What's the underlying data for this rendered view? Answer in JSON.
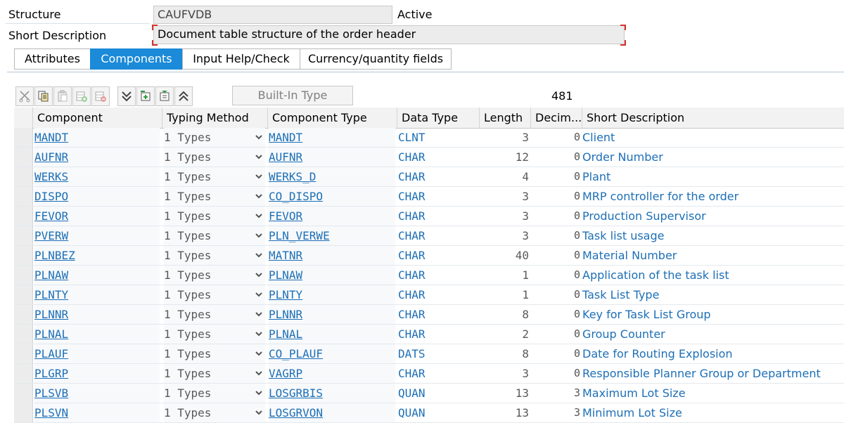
{
  "header": {
    "structure_label": "Structure",
    "structure_value": "CAUFVDB",
    "status": "Active",
    "short_desc_label": "Short Description",
    "short_desc_value": "Document table structure of the order header"
  },
  "tabs": [
    {
      "label": "Attributes",
      "active": false
    },
    {
      "label": "Components",
      "active": true
    },
    {
      "label": "Input Help/Check",
      "active": false
    },
    {
      "label": "Currency/quantity fields",
      "active": false
    }
  ],
  "toolbar": {
    "builtin_type_label": "Built-In Type",
    "count": "481",
    "icons": [
      "cut-icon",
      "copy-icon",
      "paste-icon",
      "insert-row-icon",
      "delete-row-icon",
      "collapse-icon",
      "new-field-icon",
      "new-include-icon",
      "expand-icon"
    ]
  },
  "columns": [
    "Component",
    "Typing Method",
    "Component Type",
    "Data Type",
    "Length",
    "Decim...",
    "Short Description"
  ],
  "rows": [
    {
      "component": "MANDT",
      "typing": "1 Types",
      "ctype": "MANDT",
      "dtype": "CLNT",
      "length": "3",
      "dec": "0",
      "desc": "Client"
    },
    {
      "component": "AUFNR",
      "typing": "1 Types",
      "ctype": "AUFNR",
      "dtype": "CHAR",
      "length": "12",
      "dec": "0",
      "desc": "Order Number"
    },
    {
      "component": "WERKS",
      "typing": "1 Types",
      "ctype": "WERKS_D",
      "dtype": "CHAR",
      "length": "4",
      "dec": "0",
      "desc": "Plant"
    },
    {
      "component": "DISPO",
      "typing": "1 Types",
      "ctype": "CO_DISPO",
      "dtype": "CHAR",
      "length": "3",
      "dec": "0",
      "desc": "MRP controller for the order"
    },
    {
      "component": "FEVOR",
      "typing": "1 Types",
      "ctype": "FEVOR",
      "dtype": "CHAR",
      "length": "3",
      "dec": "0",
      "desc": "Production Supervisor"
    },
    {
      "component": "PVERW",
      "typing": "1 Types",
      "ctype": "PLN_VERWE",
      "dtype": "CHAR",
      "length": "3",
      "dec": "0",
      "desc": "Task list usage"
    },
    {
      "component": "PLNBEZ",
      "typing": "1 Types",
      "ctype": "MATNR",
      "dtype": "CHAR",
      "length": "40",
      "dec": "0",
      "desc": "Material Number"
    },
    {
      "component": "PLNAW",
      "typing": "1 Types",
      "ctype": "PLNAW",
      "dtype": "CHAR",
      "length": "1",
      "dec": "0",
      "desc": "Application of the task list"
    },
    {
      "component": "PLNTY",
      "typing": "1 Types",
      "ctype": "PLNTY",
      "dtype": "CHAR",
      "length": "1",
      "dec": "0",
      "desc": "Task List Type"
    },
    {
      "component": "PLNNR",
      "typing": "1 Types",
      "ctype": "PLNNR",
      "dtype": "CHAR",
      "length": "8",
      "dec": "0",
      "desc": "Key for Task List Group"
    },
    {
      "component": "PLNAL",
      "typing": "1 Types",
      "ctype": "PLNAL",
      "dtype": "CHAR",
      "length": "2",
      "dec": "0",
      "desc": "Group Counter"
    },
    {
      "component": "PLAUF",
      "typing": "1 Types",
      "ctype": "CO_PLAUF",
      "dtype": "DATS",
      "length": "8",
      "dec": "0",
      "desc": "Date for Routing Explosion"
    },
    {
      "component": "PLGRP",
      "typing": "1 Types",
      "ctype": "VAGRP",
      "dtype": "CHAR",
      "length": "3",
      "dec": "0",
      "desc": "Responsible Planner Group or Department"
    },
    {
      "component": "PLSVB",
      "typing": "1 Types",
      "ctype": "LOSGRBIS",
      "dtype": "QUAN",
      "length": "13",
      "dec": "3",
      "desc": "Maximum Lot Size"
    },
    {
      "component": "PLSVN",
      "typing": "1 Types",
      "ctype": "LOSGRVON",
      "dtype": "QUAN",
      "length": "13",
      "dec": "3",
      "desc": "Minimum Lot Size"
    }
  ]
}
